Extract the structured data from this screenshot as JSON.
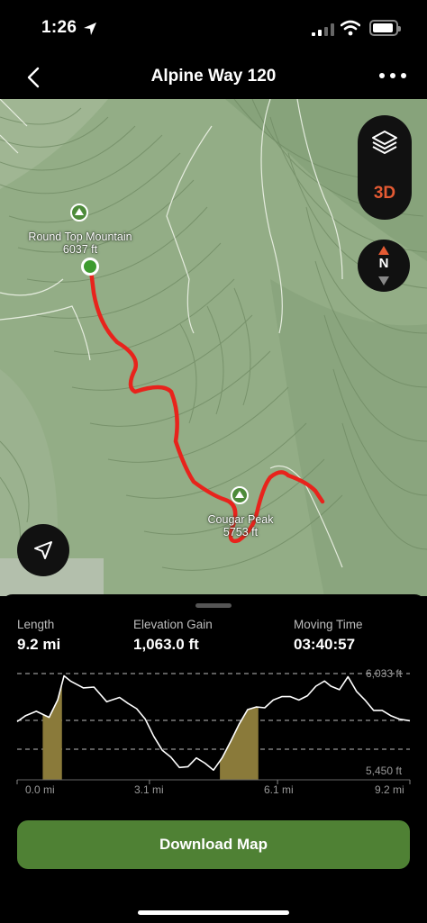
{
  "status": {
    "time": "1:26"
  },
  "nav": {
    "title": "Alpine Way 120"
  },
  "map": {
    "peaks": [
      {
        "name": "Round Top Mountain",
        "elevation": "6037 ft"
      },
      {
        "name": "Cougar Peak",
        "elevation": "5753 ft"
      }
    ],
    "mode_label": "3D",
    "compass_label": "N",
    "colors": {
      "route": "#e8231c",
      "terrain": "#93ad86",
      "accent": "#e45a33"
    }
  },
  "stats": {
    "length_label": "Length",
    "length_value": "9.2 mi",
    "gain_label": "Elevation Gain",
    "gain_value": "1,063.0 ft",
    "time_label": "Moving Time",
    "time_value": "03:40:57"
  },
  "chart_data": {
    "type": "area",
    "x_ticks": [
      "0.0 mi",
      "3.1 mi",
      "6.1 mi",
      "9.2 mi"
    ],
    "y_ticks": [
      "6,033 ft",
      "5,450 ft"
    ],
    "xlim": [
      0,
      9.2
    ],
    "ylim": [
      5450,
      6033
    ],
    "series": [
      {
        "x": [
          0.0,
          0.2,
          0.45,
          0.75,
          0.95,
          1.1,
          1.25,
          1.55,
          1.8,
          2.1,
          2.4,
          2.6,
          2.8,
          3.0,
          3.2,
          3.4,
          3.6,
          3.8,
          4.0,
          4.2,
          4.4,
          4.6,
          4.8,
          5.0,
          5.2,
          5.4,
          5.6,
          5.8,
          6.0,
          6.2,
          6.4,
          6.6,
          6.8,
          7.0,
          7.2,
          7.35,
          7.55,
          7.75,
          7.95,
          8.15,
          8.35,
          8.55,
          8.75,
          8.95,
          9.2
        ],
        "y": [
          5755,
          5790,
          5815,
          5780,
          5880,
          6020,
          5990,
          5950,
          5955,
          5870,
          5895,
          5860,
          5830,
          5770,
          5670,
          5590,
          5550,
          5490,
          5495,
          5545,
          5515,
          5475,
          5545,
          5640,
          5740,
          5825,
          5840,
          5835,
          5880,
          5900,
          5900,
          5880,
          5905,
          5960,
          5990,
          5960,
          5940,
          6015,
          5930,
          5880,
          5820,
          5820,
          5790,
          5770,
          5760
        ]
      }
    ],
    "shaded_ranges": [
      [
        0.6,
        1.05
      ],
      [
        4.75,
        5.65
      ]
    ]
  },
  "download": {
    "label": "Download Map"
  }
}
